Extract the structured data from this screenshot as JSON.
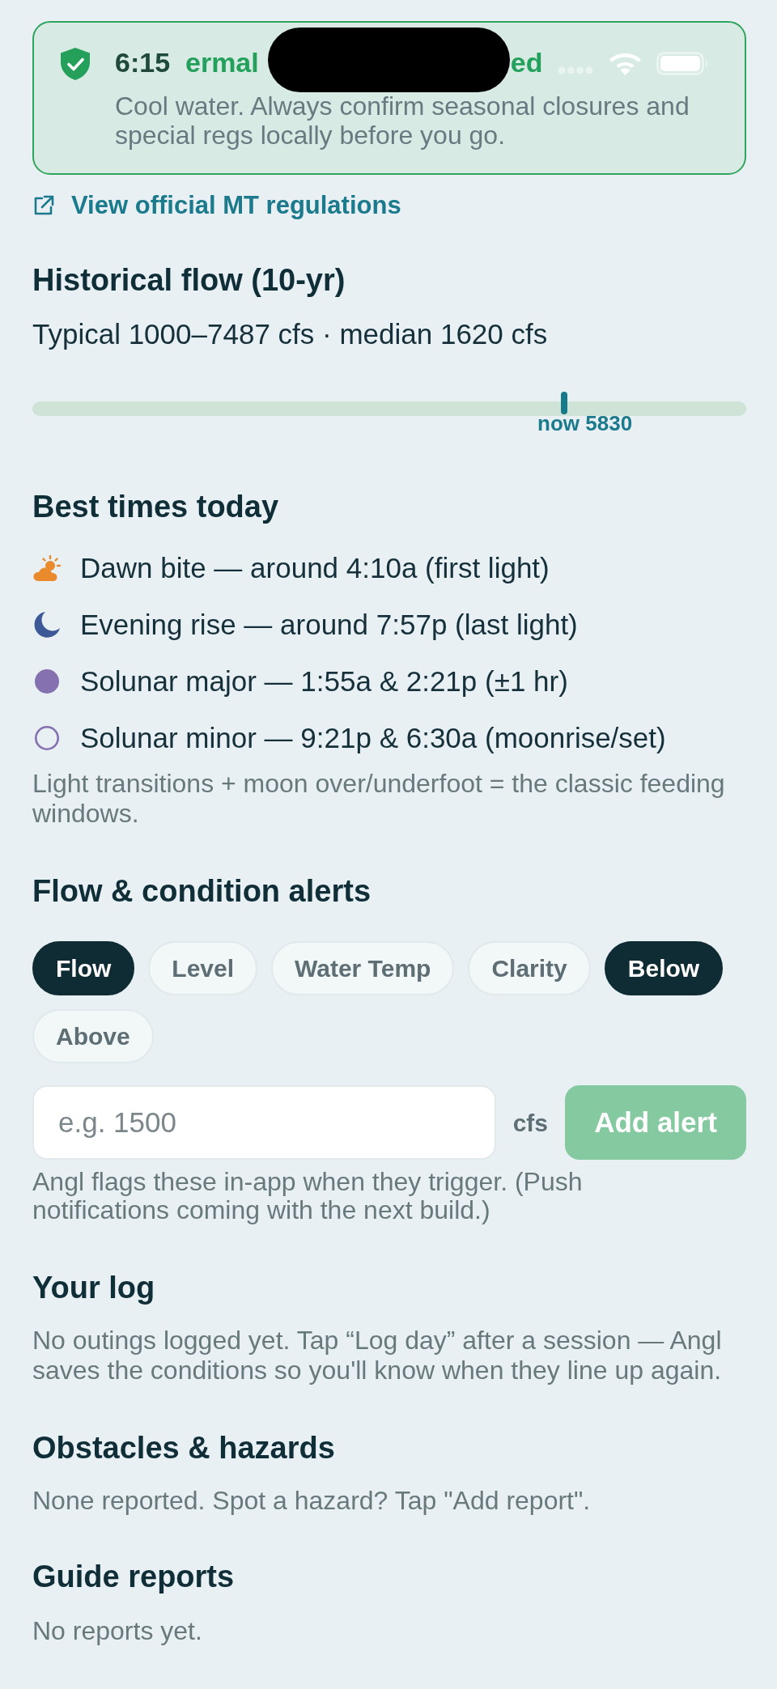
{
  "status_bar": {
    "time": "6:15"
  },
  "notice": {
    "title_start": "ermal",
    "title_end": "ed",
    "body": "Cool water. Always confirm seasonal closures and special regs locally before you go."
  },
  "regulations_link": {
    "label": "View official MT regulations"
  },
  "historical_flow": {
    "heading": "Historical flow (10-yr)",
    "summary": "Typical 1000–7487 cfs · median 1620 cfs",
    "current": {
      "level": 0.745,
      "label": "now 5830"
    }
  },
  "best_times": {
    "heading": "Best times today",
    "items": [
      {
        "kind": "dawn",
        "color": "#e98a2c",
        "text": "Dawn bite — around 4:10a (first light)"
      },
      {
        "kind": "evening",
        "color": "#3c5896",
        "text": "Evening rise — around 7:57p (last light)"
      },
      {
        "kind": "solunar_major",
        "color": "#8570b0",
        "text": "Solunar major — 1:55a & 2:21p (±1 hr)"
      },
      {
        "kind": "solunar_minor",
        "color": "#8570b0",
        "text": "Solunar minor — 9:21p & 6:30a (moonrise/set)"
      }
    ],
    "note": "Light transitions + moon over/underfoot = the classic feeding windows."
  },
  "alerts": {
    "heading": "Flow & condition alerts",
    "metrics": [
      {
        "label": "Flow",
        "selected": true
      },
      {
        "label": "Level",
        "selected": false
      },
      {
        "label": "Water Temp",
        "selected": false
      },
      {
        "label": "Clarity",
        "selected": false
      }
    ],
    "directions": [
      {
        "label": "Below",
        "selected": true
      },
      {
        "label": "Above",
        "selected": false
      }
    ],
    "threshold": {
      "placeholder": "e.g. 1500",
      "unit": "cfs"
    },
    "add_button": {
      "label": "Add alert",
      "disabled": true
    },
    "note": "Angl flags these in-app when they trigger. (Push notifications coming with the next build.)"
  },
  "log": {
    "heading": "Your log",
    "empty_text": "No outings logged yet. Tap “Log day” after a session — Angl saves the conditions so you'll know when they line up again."
  },
  "hazards": {
    "heading": "Obstacles & hazards",
    "empty_text": "None reported. Spot a hazard? Tap \"Add report\"."
  },
  "guide_reports": {
    "heading": "Guide reports",
    "empty_text": "No reports yet."
  }
}
